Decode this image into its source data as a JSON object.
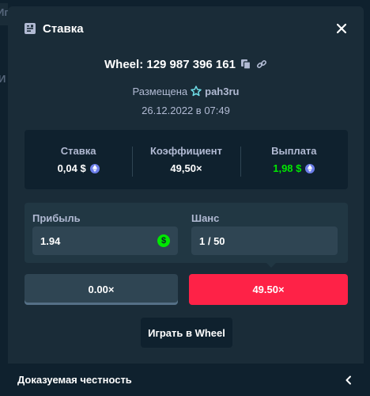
{
  "background": {
    "fragment_top": "Иг",
    "fragment_mid": "И"
  },
  "modal": {
    "title": "Ставка",
    "title_icon": "bet-slip-icon",
    "close_icon": "close-icon"
  },
  "bet": {
    "wheel_id": "Wheel: 129 987 396 161",
    "placed_label": "Размещена",
    "username": "pah3ru",
    "date": "26.12.2022 в 07:49"
  },
  "stats": {
    "stake_label": "Ставка",
    "stake_value": "0,04 $",
    "multiplier_label": "Коэффициент",
    "multiplier_value": "49,50×",
    "payout_label": "Выплата",
    "payout_value": "1,98 $"
  },
  "calc": {
    "profit_label": "Прибыль",
    "profit_value": "1.94",
    "chance_label": "Шанс",
    "chance_value": "1 / 50"
  },
  "segments": {
    "low": "0.00×",
    "high": "49.50×"
  },
  "actions": {
    "play_label": "Играть в Wheel"
  },
  "footer": {
    "fairness_label": "Доказуемая честность"
  },
  "colors": {
    "page_bg": "#0f212e",
    "modal_bg": "#1a2c38",
    "accent_green": "#00e701",
    "accent_red": "#fe2247",
    "coin": "#6c7eea"
  }
}
